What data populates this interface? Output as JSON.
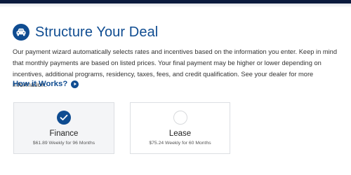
{
  "header": {
    "title": "Structure Your Deal",
    "icon": "car-icon",
    "accent_color": "#0f4c91"
  },
  "description": "Our payment wizard automatically selects rates and incentives based on the information you enter. Keep in mind that monthly payments are based on listed prices. Your final payment may be higher or lower depending on incentives, additional programs, residency, taxes, fees, and credit qualification. See your dealer for more information.",
  "how_it_works": {
    "label": "How it Works?",
    "icon": "play-circle-icon"
  },
  "options": [
    {
      "label": "Finance",
      "payment": "$61.89 Weekly for 96 Months",
      "selected": true
    },
    {
      "label": "Lease",
      "payment": "$75.24 Weekly for 60 Months",
      "selected": false
    }
  ]
}
